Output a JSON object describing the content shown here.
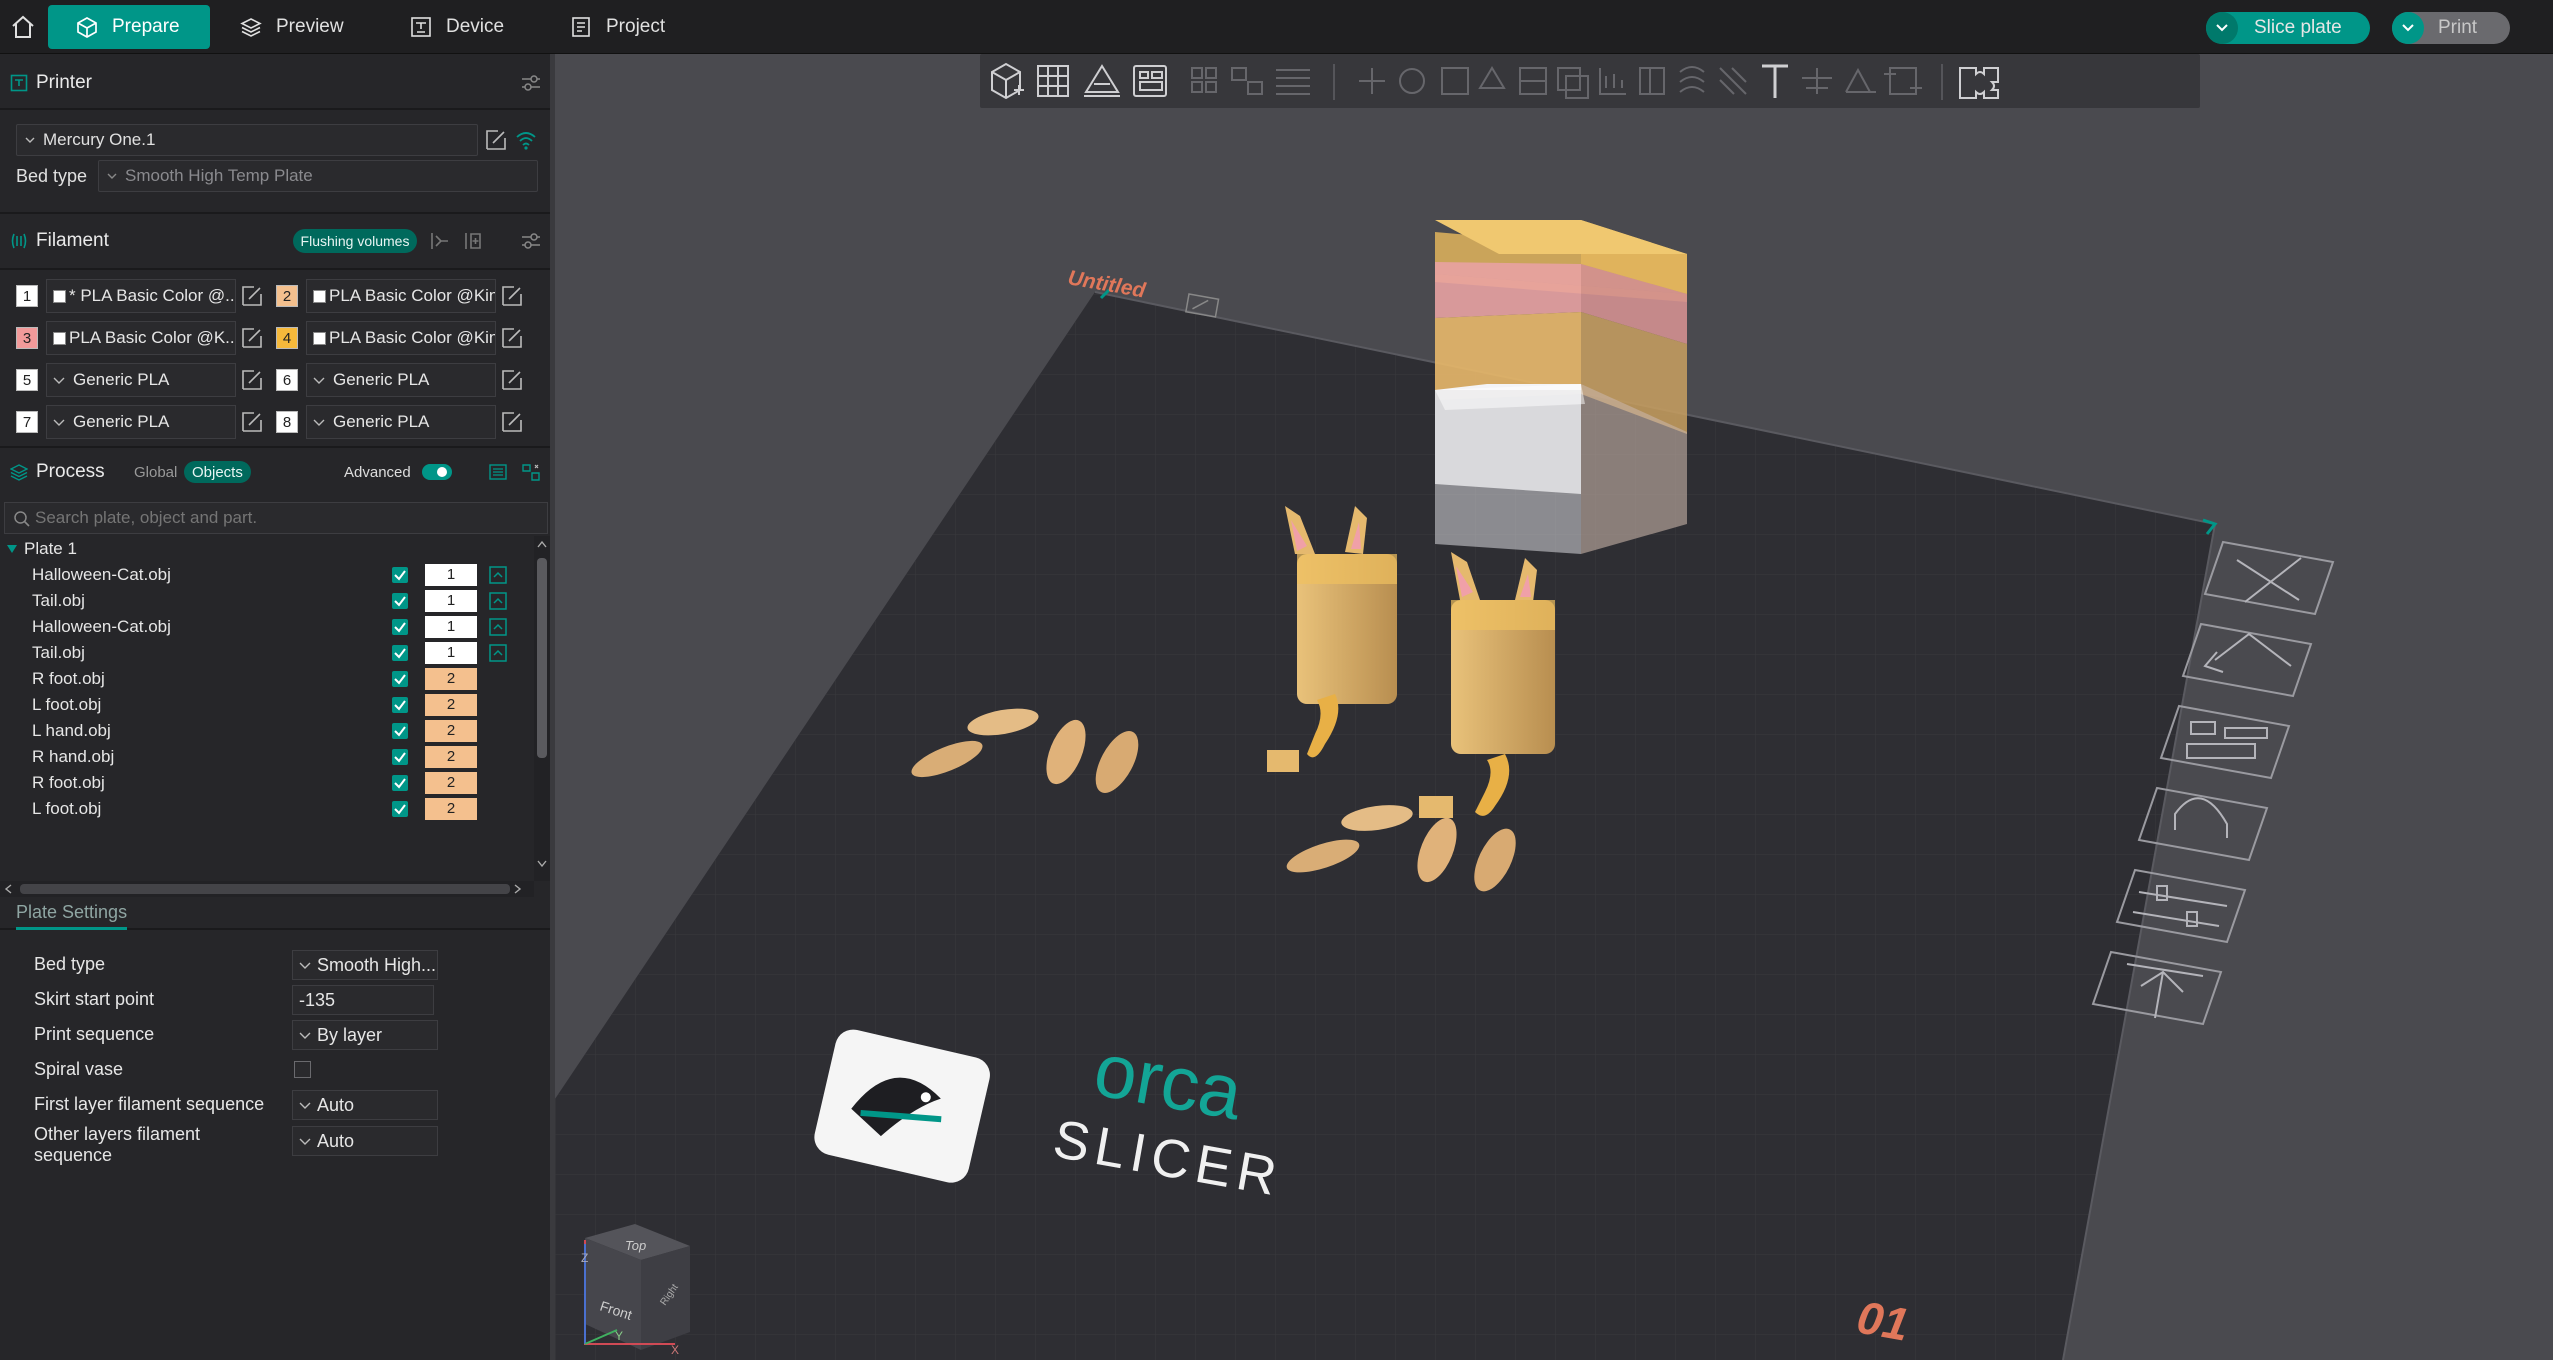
{
  "topbar": {
    "tabs": [
      {
        "label": "Prepare",
        "icon": "cube-icon",
        "active": true
      },
      {
        "label": "Preview",
        "icon": "layers-icon",
        "active": false
      },
      {
        "label": "Device",
        "icon": "device-icon",
        "active": false
      },
      {
        "label": "Project",
        "icon": "project-icon",
        "active": false
      }
    ],
    "slice_label": "Slice plate",
    "print_label": "Print"
  },
  "printer": {
    "title": "Printer",
    "name": "Mercury One.1",
    "bed_type_label": "Bed type",
    "bed_type_value": "Smooth High Temp Plate"
  },
  "filament": {
    "title": "Filament",
    "flushing_label": "Flushing volumes",
    "items": [
      {
        "num": "1",
        "name": "* PLA Basic Color @...",
        "color": "#ffffff",
        "swatch": true
      },
      {
        "num": "2",
        "name": "PLA Basic Color @Kin...",
        "color": "#f4c08e",
        "swatch": true
      },
      {
        "num": "3",
        "name": "PLA Basic Color @K...",
        "color": "#f29a9a",
        "swatch": true
      },
      {
        "num": "4",
        "name": "PLA Basic Color @Kin...",
        "color": "#f6b93b",
        "swatch": true
      },
      {
        "num": "5",
        "name": "Generic PLA",
        "color": "#ffffff",
        "swatch": false
      },
      {
        "num": "6",
        "name": "Generic PLA",
        "color": "#ffffff",
        "swatch": false
      },
      {
        "num": "7",
        "name": "Generic PLA",
        "color": "#ffffff",
        "swatch": false
      },
      {
        "num": "8",
        "name": "Generic PLA",
        "color": "#ffffff",
        "swatch": false
      }
    ]
  },
  "process": {
    "title": "Process",
    "global_label": "Global",
    "objects_label": "Objects",
    "advanced_label": "Advanced"
  },
  "search": {
    "placeholder": "Search plate, object and part."
  },
  "objects": {
    "plate_label": "Plate 1",
    "rows": [
      {
        "name": "Halloween-Cat.obj",
        "filament": "1",
        "color": "#ffffff"
      },
      {
        "name": "Tail.obj",
        "filament": "1",
        "color": "#ffffff"
      },
      {
        "name": "Halloween-Cat.obj",
        "filament": "1",
        "color": "#ffffff"
      },
      {
        "name": "Tail.obj",
        "filament": "1",
        "color": "#ffffff"
      },
      {
        "name": "R foot.obj",
        "filament": "2",
        "color": "#f4c08e"
      },
      {
        "name": "L foot.obj",
        "filament": "2",
        "color": "#f4c08e"
      },
      {
        "name": "L hand.obj",
        "filament": "2",
        "color": "#f4c08e"
      },
      {
        "name": "R hand.obj",
        "filament": "2",
        "color": "#f4c08e"
      },
      {
        "name": "R foot.obj",
        "filament": "2",
        "color": "#f4c08e"
      },
      {
        "name": "L foot.obj",
        "filament": "2",
        "color": "#f4c08e"
      }
    ]
  },
  "plate_settings": {
    "title": "Plate Settings",
    "rows": [
      {
        "label": "Bed type",
        "value": "Smooth High...",
        "dropdown": true,
        "checkbox": false
      },
      {
        "label": "Skirt start point",
        "value": "-135",
        "dropdown": false,
        "checkbox": false
      },
      {
        "label": "Print sequence",
        "value": "By layer",
        "dropdown": true,
        "checkbox": false
      },
      {
        "label": "Spiral vase",
        "value": "",
        "dropdown": false,
        "checkbox": true
      },
      {
        "label": "First layer filament sequence",
        "value": "Auto",
        "dropdown": true,
        "checkbox": false
      },
      {
        "label": "Other layers filament sequence",
        "value": "Auto",
        "dropdown": true,
        "checkbox": false
      }
    ]
  },
  "viewport": {
    "plate_name": "Untitled",
    "plate_number": "01",
    "logo_top": "orca",
    "logo_bottom": "SLICER",
    "view_cube_top": "Top",
    "view_cube_front": "Front",
    "view_cube_side": "Right",
    "axis_z": "Z",
    "axis_y": "Y",
    "axis_x": "X"
  },
  "colors": {
    "accent": "#009688",
    "bed": "#2d2d31",
    "viewport_bg": "#4a4a4f"
  }
}
